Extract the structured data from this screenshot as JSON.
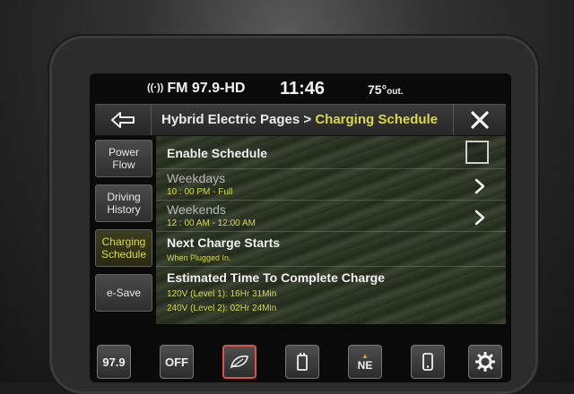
{
  "status": {
    "radio": "FM 97.9-HD",
    "time": "11:46",
    "temp": "75°",
    "temp_unit": "out."
  },
  "header": {
    "breadcrumb_parent": "Hybrid Electric Pages >",
    "breadcrumb_current": "Charging Schedule"
  },
  "sidenav": {
    "items": [
      {
        "line1": "Power",
        "line2": "Flow"
      },
      {
        "line1": "Driving",
        "line2": "History"
      },
      {
        "line1": "Charging",
        "line2": "Schedule"
      },
      {
        "line1": "e-Save",
        "line2": ""
      }
    ]
  },
  "schedule": {
    "enable_label": "Enable Schedule",
    "enable_checked": false,
    "weekdays_label": "Weekdays",
    "weekdays_value": "10 : 00 PM - Full",
    "weekends_label": "Weekends",
    "weekends_value": "12 : 00 AM - 12:00 AM",
    "next_charge_label": "Next Charge Starts",
    "next_charge_value": "When Plugged In.",
    "estimate_label": "Estimated Time To Complete Charge",
    "estimate_l1": "120V (Level 1): 16Hr 31Min",
    "estimate_l2": "240V (Level 2): 02Hr 24Min"
  },
  "dock": {
    "radio_preset": "97.9",
    "climate_state": "OFF",
    "compass": "NE"
  },
  "colors": {
    "accent": "#d8d84a",
    "eco_border": "#d9534f"
  }
}
